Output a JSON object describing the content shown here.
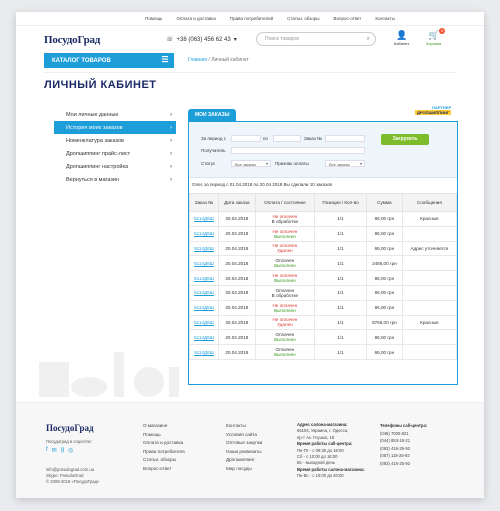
{
  "topnav": [
    "Помощь",
    "Оплата и доставка",
    "Права потребителей",
    "Статьи, обзоры",
    "Вопрос-ответ",
    "Контакты"
  ],
  "header": {
    "logo": "ПосудоГрад",
    "phone": "+38 (063) 456 62 43",
    "phone_arrow": "▾",
    "search_placeholder": "Поиск товаров",
    "cabinet_label": "Кабинет",
    "cart_label": "Корзина",
    "cart_count": "0"
  },
  "catalog_button": "КАТАЛОГ ТОВАРОВ",
  "breadcrumb": {
    "home": "Главная",
    "sep": " / ",
    "current": "Личный кабинет"
  },
  "page_title": "ЛИЧНЫЙ КАБИНЕТ",
  "sidebar": [
    {
      "label": "Мои личные данные",
      "active": false
    },
    {
      "label": "История моих заказов",
      "active": true
    },
    {
      "label": "Номенклатура заказов",
      "active": false
    },
    {
      "label": "Дропшиппинг прайс-лист",
      "active": false
    },
    {
      "label": "Дропшиппинг настройка",
      "active": false
    },
    {
      "label": "Вернуться в магазин",
      "active": false
    }
  ],
  "tab_label": "МОИ ЗАКАЗЫ",
  "partner": {
    "line1": "ПАРТНЕР",
    "line2": "ДРОПШИППИНГ"
  },
  "filters": {
    "period_from": "За период с",
    "period_to": "по",
    "order_num": "Заказ №",
    "recipient": "Получатель",
    "status": "Статус",
    "status_value": "Все заказы",
    "payment": "Признак оплаты",
    "payment_value": "Все заказы",
    "load_button": "Загрузить"
  },
  "summary": "Олег, за период с 01.04.2018 по 20.04.2018 Вы сделали 10 заказов",
  "columns": [
    "Заказ №",
    "Дата заказа",
    "Оплата / состояние",
    "Позиция / Кол-во",
    "Сумма",
    "Сообщения"
  ],
  "orders": [
    {
      "num": "5114Д6Ш",
      "date": "20.04.2018",
      "pay": "Не оплачен",
      "pay_cls": "no",
      "state": "В обработке",
      "state_cls": "g",
      "qty": "1/1",
      "sum": "86,00 грн",
      "msg": "Красные"
    },
    {
      "num": "5114Д6Ш",
      "date": "20.04.2018",
      "pay": "Не оплачен",
      "pay_cls": "no",
      "state": "Выполнен",
      "state_cls": "ok",
      "qty": "1/1",
      "sum": "86,00 грн",
      "msg": ""
    },
    {
      "num": "5114Д6Ш",
      "date": "20.04.2018",
      "pay": "Не оплачен",
      "pay_cls": "no",
      "state": "Удален",
      "state_cls": "no",
      "qty": "1/1",
      "sum": "86,00 грн",
      "msg": "Адрес уточняется"
    },
    {
      "num": "5114Д6Ш",
      "date": "20.04.2018",
      "pay": "Оплачен",
      "pay_cls": "g",
      "state": "Выполнен",
      "state_cls": "ok",
      "qty": "1/1",
      "sum": "2486,00 грн",
      "msg": ""
    },
    {
      "num": "5114Д6Ш",
      "date": "20.04.2018",
      "pay": "Не оплачен",
      "pay_cls": "no",
      "state": "Выполнен",
      "state_cls": "ok",
      "qty": "1/1",
      "sum": "86,00 грн",
      "msg": ""
    },
    {
      "num": "5114Д6Ш",
      "date": "20.04.2018",
      "pay": "Оплачен",
      "pay_cls": "g",
      "state": "В обработке",
      "state_cls": "g",
      "qty": "1/1",
      "sum": "86,00 грн",
      "msg": ""
    },
    {
      "num": "5114Д6Ш",
      "date": "20.04.2018",
      "pay": "Не оплачен",
      "pay_cls": "no",
      "state": "Выполнен",
      "state_cls": "ok",
      "qty": "1/1",
      "sum": "86,00 грн",
      "msg": ""
    },
    {
      "num": "5114Д6Ш",
      "date": "20.04.2018",
      "pay": "Не оплачен",
      "pay_cls": "no",
      "state": "Удален",
      "state_cls": "no",
      "qty": "1/1",
      "sum": "8766,00 грн",
      "msg": "Красные"
    },
    {
      "num": "5114Д6Ш",
      "date": "20.04.2018",
      "pay": "Оплачен",
      "pay_cls": "g",
      "state": "Выполнен",
      "state_cls": "ok",
      "qty": "1/1",
      "sum": "86,00 грн",
      "msg": ""
    },
    {
      "num": "5114Д6Ш",
      "date": "20.04.2018",
      "pay": "Оплачен",
      "pay_cls": "g",
      "state": "Выполнен",
      "state_cls": "ok",
      "qty": "1/1",
      "sum": "86,00 грн",
      "msg": ""
    }
  ],
  "footer": {
    "logo": "ПосудоГрад",
    "social_label": "Посудоград в соцсетях:",
    "social_icons": [
      "f",
      "✉",
      "g",
      "◎"
    ],
    "email": "info@posudograd.com.ua",
    "skype": "Skype: PosudoGrad",
    "copyright": "© 2009-2018 «ПосудоГрад»",
    "col1": [
      "О магазине",
      "Помощь",
      "Оплата и доставка",
      "Права потребителя",
      "Статьи, обзоры",
      "Вопрос-ответ"
    ],
    "col2": [
      "Контакты",
      "Условия сайта",
      "Оптовые закупки",
      "Наши реквизиты",
      "Дропшиппинг",
      "Мир посуды"
    ],
    "address_title": "Адрес салона-магазина:",
    "address": [
      "65104, Украина, г. Одесса,",
      "пр-т Ак. Глушко, 18"
    ],
    "hours_title": "Время работы call-центра:",
    "hours": [
      "Пн-Пт - с 09:30 до 18:00",
      "Сб - с 10:00 до 16:00",
      "Вс - выходной день"
    ],
    "salon_title": "Время работы салона-магазина:",
    "salon": [
      "Пн-Вс - с 10:00 до 20:00"
    ],
    "phones_title": "Телефоны call-центра:",
    "phones": [
      "(048) 7000-821",
      "(044) 853-18-21",
      "(093) 416-25-92",
      "(067) 118-25-92",
      "(093) 416-25-92"
    ]
  }
}
